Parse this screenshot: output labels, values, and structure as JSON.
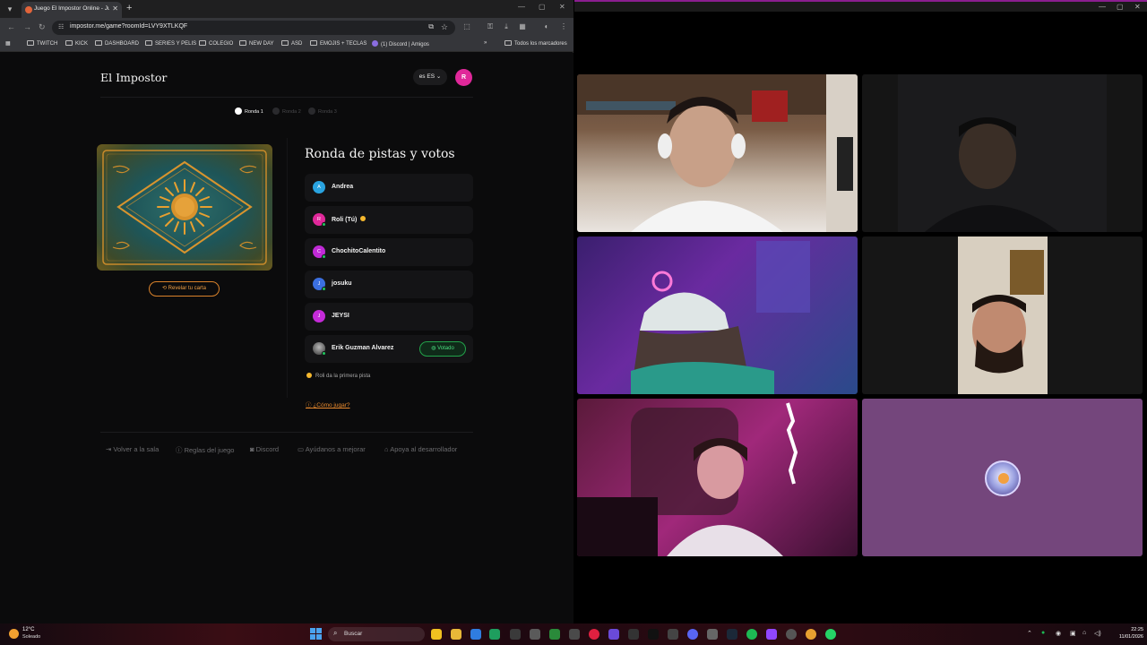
{
  "browser": {
    "tab_title": "Juego El Impostor Online - Jug",
    "url": "impostor.me/game?roomId=LVY9XTLKQF",
    "bookmarks": [
      "TWITCH",
      "KICK",
      "DASHBOARD",
      "SERIES Y PELIS",
      "COLEGIO",
      "NEW DAY",
      "ASD",
      "EMOJIS + TECLAS",
      "(1) Discord | Amigos"
    ],
    "all_bookmarks": "Todos los marcadores"
  },
  "game": {
    "brand": "El Impostor",
    "language": "ES",
    "language_code": "es",
    "user_initial": "R",
    "rounds": [
      {
        "label": "Ronda 1",
        "active": true
      },
      {
        "label": "Ronda 2",
        "active": false
      },
      {
        "label": "Ronda 3",
        "active": false
      }
    ],
    "reveal_label": "Revelar tu carta",
    "heading": "Ronda de pistas y votos",
    "players": [
      {
        "initial": "A",
        "name": "Andrea",
        "color": "#29a3e0",
        "online": false,
        "turn": false,
        "voted": false
      },
      {
        "initial": "R",
        "name": "Roli (Tú)",
        "color": "#e0289a",
        "online": true,
        "turn": true,
        "voted": false
      },
      {
        "initial": "C",
        "name": "ChochitoCalentito",
        "color": "#c02ad6",
        "online": true,
        "turn": false,
        "voted": false
      },
      {
        "initial": "J",
        "name": "josuku",
        "color": "#3b6fe0",
        "online": true,
        "turn": false,
        "voted": false
      },
      {
        "initial": "J",
        "name": "JEYSI",
        "color": "#c42ad8",
        "online": false,
        "turn": false,
        "voted": false
      },
      {
        "initial": "",
        "name": "Erik Guzman Alvarez",
        "color": "#6b6b6b",
        "online": true,
        "turn": false,
        "voted": true
      }
    ],
    "voted_label": "Votado",
    "hint": "Roli da la primera pista",
    "how_to": "¿Cómo jugar?",
    "footer": [
      "Volver a la sala",
      "Reglas del juego",
      "Discord",
      "Ayúdanos a mejorar",
      "Apoya al desarrollador"
    ]
  },
  "taskbar": {
    "temperature": "12°C",
    "weather": "Soleado",
    "search_label": "Buscar",
    "time": "22:25",
    "date": "11/01/2026"
  },
  "colors": {
    "accent_pink": "#e0289a",
    "accent_orange": "#e98a2e",
    "voted_green": "#4ade80",
    "call_tile_purple": "#74467c"
  }
}
